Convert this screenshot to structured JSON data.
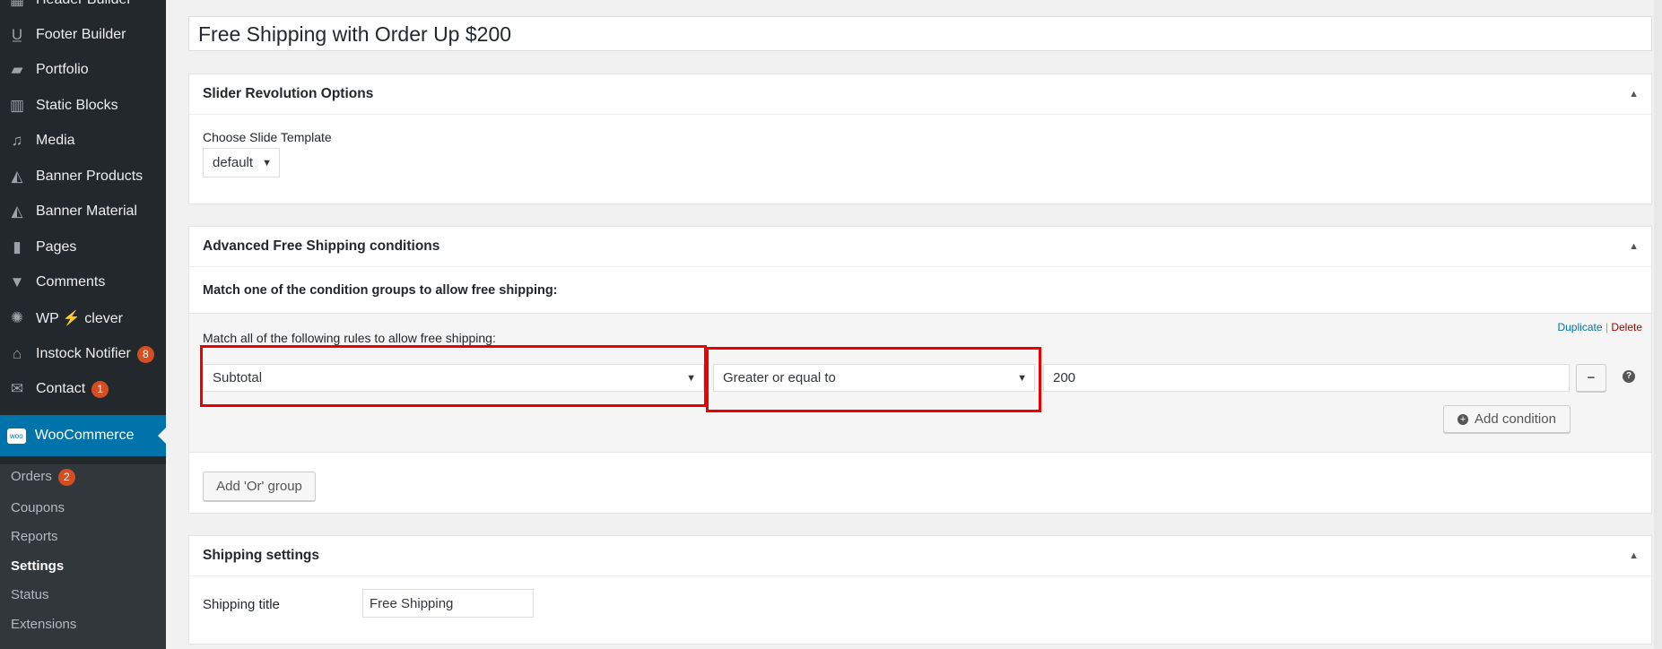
{
  "sidebar": {
    "items": [
      {
        "label": "Header Builder",
        "icon": "header-icon"
      },
      {
        "label": "Footer Builder",
        "icon": "underline-icon"
      },
      {
        "label": "Portfolio",
        "icon": "folder-icon"
      },
      {
        "label": "Static Blocks",
        "icon": "blocks-icon"
      },
      {
        "label": "Media",
        "icon": "media-icon"
      },
      {
        "label": "Banner Products",
        "icon": "map-icon"
      },
      {
        "label": "Banner Material",
        "icon": "map-icon"
      },
      {
        "label": "Pages",
        "icon": "pages-icon"
      },
      {
        "label": "Comments",
        "icon": "comment-icon"
      },
      {
        "label": "WP ⚡ clever",
        "icon": "bulb-icon"
      },
      {
        "label": "Instock Notifier",
        "icon": "bank-icon",
        "badge": "8"
      },
      {
        "label": "Contact",
        "icon": "mail-icon",
        "badge": "1"
      }
    ],
    "active": {
      "label": "WooCommerce",
      "icon": "woo-icon"
    },
    "sub": [
      {
        "label": "Orders",
        "badge": "2"
      },
      {
        "label": "Coupons"
      },
      {
        "label": "Reports"
      },
      {
        "label": "Settings",
        "current": true
      },
      {
        "label": "Status"
      },
      {
        "label": "Extensions"
      }
    ]
  },
  "title": "Free Shipping with Order Up $200",
  "slider": {
    "heading": "Slider Revolution Options",
    "label": "Choose Slide Template",
    "value": "default"
  },
  "conditions": {
    "heading": "Advanced Free Shipping conditions",
    "intro": "Match one of the condition groups to allow free shipping:",
    "group_label": "Match all of the following rules to allow free shipping:",
    "duplicate": "Duplicate",
    "sep": "|",
    "delete": "Delete",
    "field": "Subtotal",
    "operator": "Greater or equal to",
    "value": "200",
    "remove": "−",
    "help": "?",
    "add_condition": "Add condition",
    "add_or": "Add 'Or' group"
  },
  "shipping": {
    "heading": "Shipping settings",
    "label": "Shipping title",
    "value": "Free Shipping"
  },
  "colors": {
    "sidebar": "#23282d",
    "accent": "#0073aa",
    "highlight": "#e00000"
  }
}
